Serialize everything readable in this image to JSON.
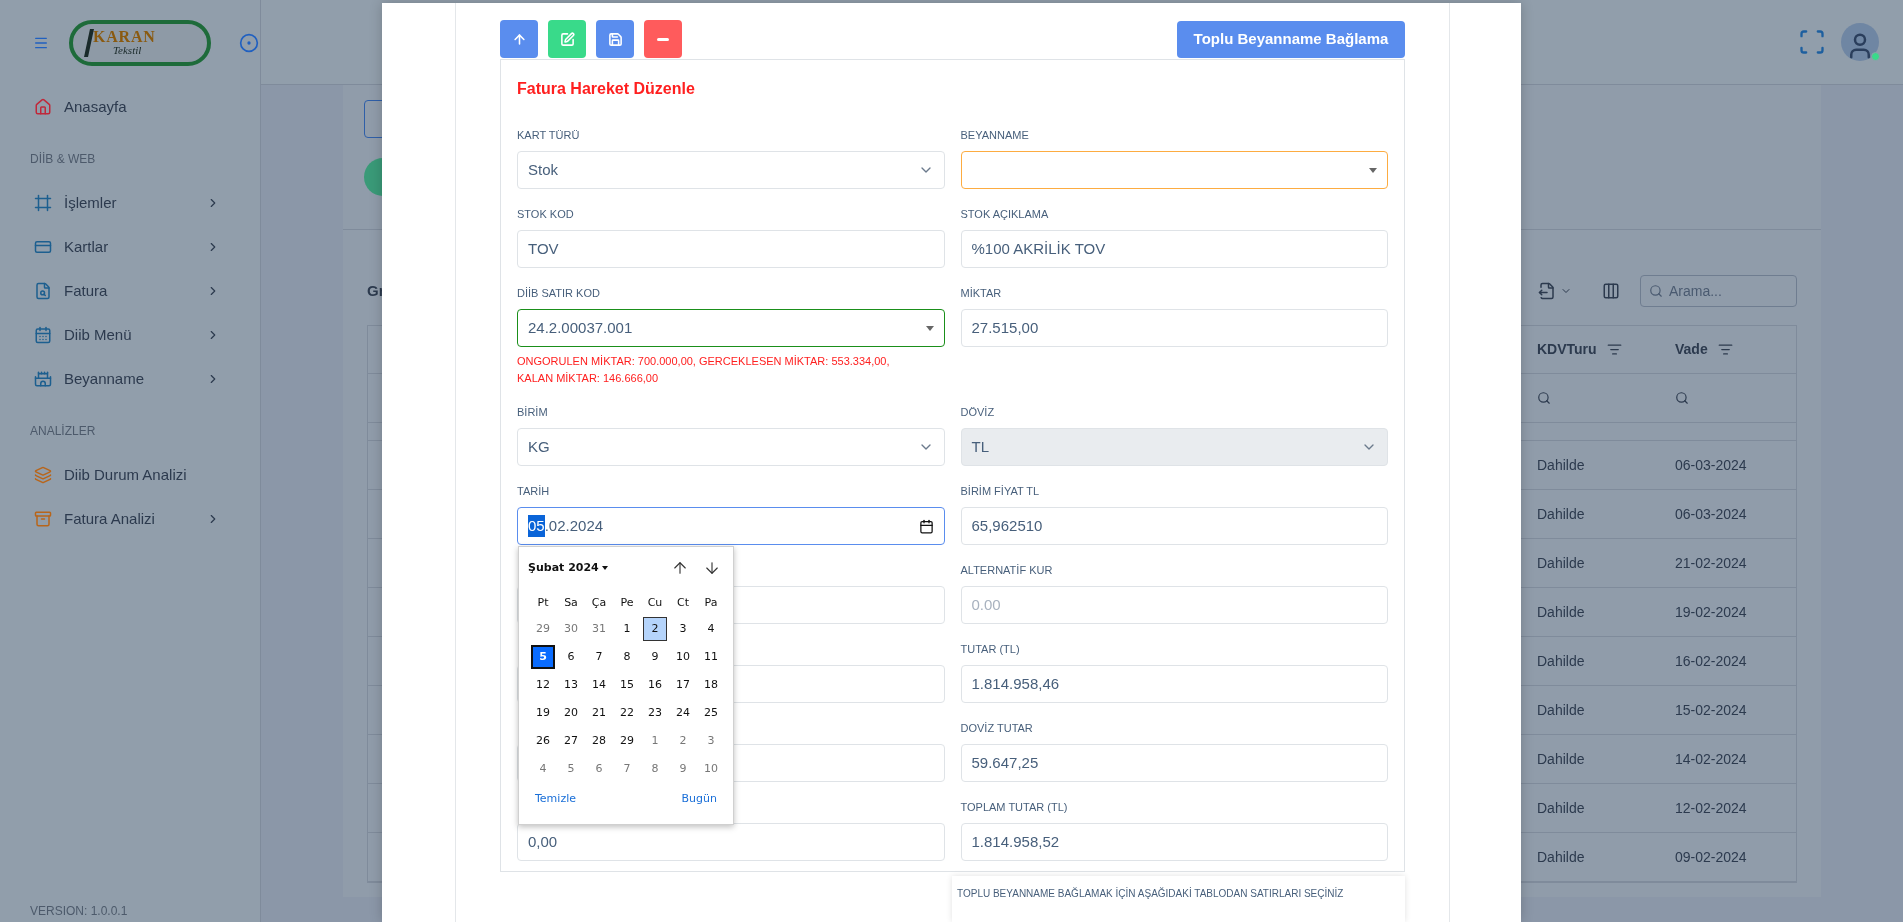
{
  "logo": {
    "name": "KARAN",
    "tagline": "Tekstil"
  },
  "sidebar": {
    "sections": [
      {
        "items": [
          {
            "label": "Anasayfa",
            "submenu": false
          }
        ]
      },
      {
        "title": "DİİB & WEB",
        "items": [
          {
            "label": "İşlemler",
            "submenu": true
          },
          {
            "label": "Kartlar",
            "submenu": true
          },
          {
            "label": "Fatura",
            "submenu": true
          },
          {
            "label": "Diib Menü",
            "submenu": true
          },
          {
            "label": "Beyanname",
            "submenu": true
          }
        ]
      },
      {
        "title": "ANALİZLER",
        "items": [
          {
            "label": "Diib Durum Analizi",
            "submenu": false
          },
          {
            "label": "Fatura Analizi",
            "submenu": true
          }
        ]
      }
    ],
    "version": "VERSION: 1.0.0.1"
  },
  "topbar": {
    "user": {
      "online": true
    }
  },
  "grid": {
    "title": "Gr",
    "search": {
      "placeholder": "Arama..."
    },
    "columns": [
      "KDVTuru",
      "Vade"
    ],
    "rows": [
      [
        "Dahilde",
        "06-03-2024"
      ],
      [
        "Dahilde",
        "06-03-2024"
      ],
      [
        "Dahilde",
        "21-02-2024"
      ],
      [
        "Dahilde",
        "19-02-2024"
      ],
      [
        "Dahilde",
        "16-02-2024"
      ],
      [
        "Dahilde",
        "15-02-2024"
      ],
      [
        "Dahilde",
        "14-02-2024"
      ],
      [
        "Dahilde",
        "12-02-2024"
      ],
      [
        "Dahilde",
        "09-02-2024"
      ]
    ]
  },
  "modal": {
    "toolbar": [
      {
        "kind": "up",
        "color": "#5a8dee"
      },
      {
        "kind": "edit",
        "color": "#39da8a"
      },
      {
        "kind": "save",
        "color": "#5a8dee"
      },
      {
        "kind": "remove",
        "color": "#ff5b5c"
      }
    ],
    "bulk_button": "Toplu Beyanname Bağlama",
    "form": {
      "title": "Fatura Hareket Düzenle",
      "fields": [
        {
          "label": "KART TÜRÜ",
          "kind": "select",
          "value": "Stok",
          "disabled": false
        },
        {
          "label": "BEYANNAME",
          "kind": "combo",
          "color": "#fdac41"
        },
        {
          "label": "STOK KOD",
          "kind": "text",
          "value": "TOV"
        },
        {
          "label": "STOK AÇIKLAMA",
          "kind": "text",
          "value": "%100 AKRİLİK TOV"
        },
        {
          "label": "DİİB SATIR KOD",
          "kind": "combo",
          "value": "24.2.00037.001",
          "color": "#1a8f1a",
          "hint": "ONGORULEN MİKTAR: 700.000,00, GERCEKLESEN MİKTAR: 553.334,00, KALAN MİKTAR: 146.666,00"
        },
        {
          "label": "MİKTAR",
          "kind": "text",
          "value": "27.515,00"
        },
        {
          "label": "BİRİM",
          "kind": "select",
          "value": "KG",
          "disabled": false
        },
        {
          "label": "DÖVİZ",
          "kind": "select",
          "value": "TL",
          "disabled": true
        },
        {
          "label": "TARİH",
          "kind": "date",
          "color": "#5a8dee",
          "value_parts": [
            {
              "text": "05",
              "selected": true
            },
            {
              "text": ".02.2024",
              "selected": false
            }
          ]
        },
        {
          "label": "BİRİM FİYAT TL",
          "kind": "text",
          "value": "65,962510"
        },
        {
          "kind": "text"
        },
        {
          "label": "ALTERNATİF KUR",
          "kind": "text",
          "placeholder": "0.00"
        },
        {
          "kind": "text"
        },
        {
          "label": "TUTAR (TL)",
          "kind": "text",
          "value": "1.814.958,46"
        },
        {
          "kind": "text"
        },
        {
          "label": "DOVİZ TUTAR",
          "kind": "text",
          "value": "59.647,25"
        },
        {
          "kind": "text",
          "value": "0,00"
        },
        {
          "label": "TOPLAM TUTAR (TL)",
          "kind": "text",
          "value": "1.814.958,52"
        }
      ],
      "calendar": {
        "month": "Şubat 2024",
        "weekdays": [
          "Pt",
          "Sa",
          "Ça",
          "Pe",
          "Cu",
          "Ct",
          "Pa"
        ],
        "weeks": [
          [
            {
              "d": "29",
              "muted": true
            },
            {
              "d": "30",
              "muted": true
            },
            {
              "d": "31",
              "muted": true
            },
            {
              "d": "1",
              "muted": false
            },
            {
              "d": "2",
              "muted": false,
              "today": true
            },
            {
              "d": "3",
              "muted": false
            },
            {
              "d": "4",
              "muted": false
            }
          ],
          [
            {
              "d": "5",
              "muted": false,
              "selected": true
            },
            {
              "d": "6",
              "muted": false
            },
            {
              "d": "7",
              "muted": false
            },
            {
              "d": "8",
              "muted": false
            },
            {
              "d": "9",
              "muted": false
            },
            {
              "d": "10",
              "muted": false
            },
            {
              "d": "11",
              "muted": false
            }
          ],
          [
            {
              "d": "12",
              "muted": false
            },
            {
              "d": "13",
              "muted": false
            },
            {
              "d": "14",
              "muted": false
            },
            {
              "d": "15",
              "muted": false
            },
            {
              "d": "16",
              "muted": false
            },
            {
              "d": "17",
              "muted": false
            },
            {
              "d": "18",
              "muted": false
            }
          ],
          [
            {
              "d": "19",
              "muted": false
            },
            {
              "d": "20",
              "muted": false
            },
            {
              "d": "21",
              "muted": false
            },
            {
              "d": "22",
              "muted": false
            },
            {
              "d": "23",
              "muted": false
            },
            {
              "d": "24",
              "muted": false
            },
            {
              "d": "25",
              "muted": false
            }
          ],
          [
            {
              "d": "26",
              "muted": false
            },
            {
              "d": "27",
              "muted": false
            },
            {
              "d": "28",
              "muted": false
            },
            {
              "d": "29",
              "muted": false
            },
            {
              "d": "1",
              "muted": true
            },
            {
              "d": "2",
              "muted": true
            },
            {
              "d": "3",
              "muted": true
            }
          ],
          [
            {
              "d": "4",
              "muted": true
            },
            {
              "d": "5",
              "muted": true
            },
            {
              "d": "6",
              "muted": true
            },
            {
              "d": "7",
              "muted": true
            },
            {
              "d": "8",
              "muted": true
            },
            {
              "d": "9",
              "muted": true
            },
            {
              "d": "10",
              "muted": true
            }
          ]
        ],
        "clear": "Temizle",
        "today": "Bugün"
      }
    },
    "note": "TOPLU BEYANNAME BAĞLAMAK İÇİN AŞAĞIDAKİ TABLODAN SATIRLARI SEÇİNİZ"
  }
}
